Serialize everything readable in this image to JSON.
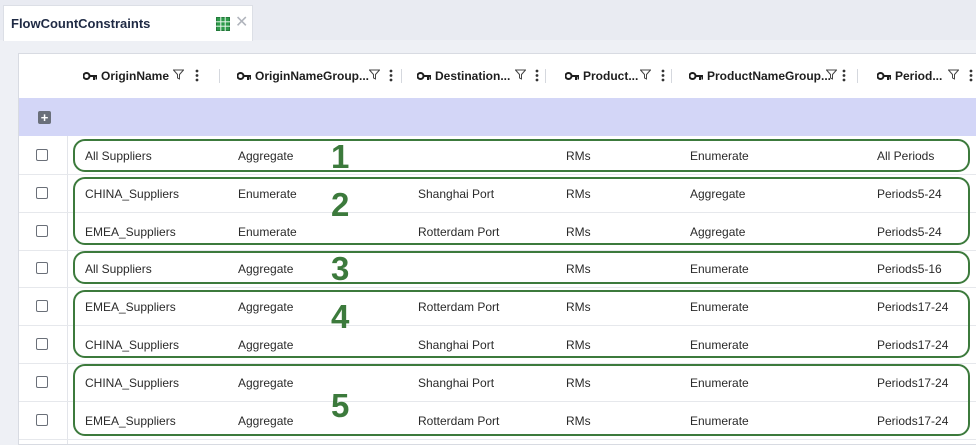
{
  "tab": {
    "title": "FlowCountConstraints",
    "grid_icon": "table-grid-icon",
    "close_glyph": "✕"
  },
  "columns": [
    "OriginName",
    "OriginNameGroup...",
    "Destination...",
    "Product...",
    "ProductNameGroup...",
    "Period..."
  ],
  "add_row_glyph": "+",
  "rows": [
    [
      "All Suppliers",
      "Aggregate",
      "",
      "RMs",
      "Enumerate",
      "All Periods"
    ],
    [
      "CHINA_Suppliers",
      "Enumerate",
      "Shanghai Port",
      "RMs",
      "Aggregate",
      "Periods5-24"
    ],
    [
      "EMEA_Suppliers",
      "Enumerate",
      "Rotterdam Port",
      "RMs",
      "Aggregate",
      "Periods5-24"
    ],
    [
      "All Suppliers",
      "Aggregate",
      "",
      "RMs",
      "Enumerate",
      "Periods5-16"
    ],
    [
      "EMEA_Suppliers",
      "Aggregate",
      "Rotterdam Port",
      "RMs",
      "Enumerate",
      "Periods17-24"
    ],
    [
      "CHINA_Suppliers",
      "Aggregate",
      "Shanghai Port",
      "RMs",
      "Enumerate",
      "Periods17-24"
    ],
    [
      "CHINA_Suppliers",
      "Aggregate",
      "Shanghai Port",
      "RMs",
      "Enumerate",
      "Periods17-24"
    ],
    [
      "EMEA_Suppliers",
      "Aggregate",
      "Rotterdam Port",
      "RMs",
      "Enumerate",
      "Periods17-24"
    ]
  ],
  "annotations": [
    "1",
    "2",
    "3",
    "4",
    "5"
  ],
  "colors": {
    "annotation": "#3c7a3c",
    "new_row_band": "#d3d6f7",
    "tab_title": "#1f2a44"
  }
}
